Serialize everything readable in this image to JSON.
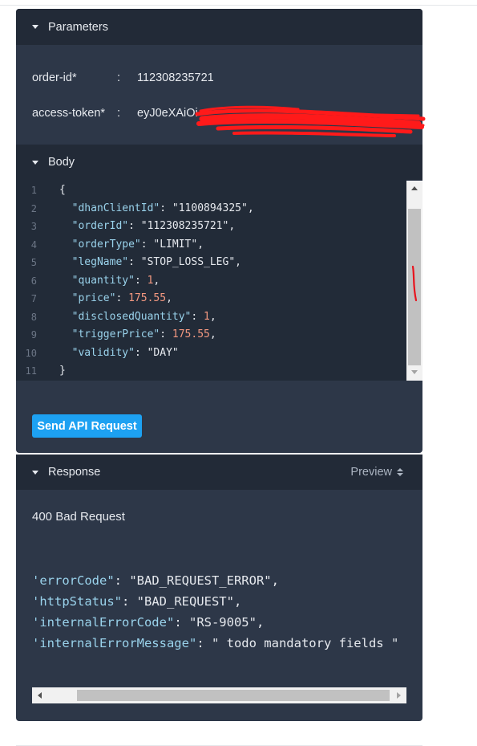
{
  "parameters": {
    "title": "Parameters",
    "rows": [
      {
        "name": "order-id*",
        "value": "112308235721"
      },
      {
        "name": "access-token*",
        "value": "eyJ0eXAiOi"
      }
    ],
    "separator": ":"
  },
  "body": {
    "title": "Body",
    "line_numbers": [
      "1",
      "2",
      "3",
      "4",
      "5",
      "6",
      "7",
      "8",
      "9",
      "10",
      "11"
    ],
    "open_brace": "{",
    "close_brace": "}",
    "fields": [
      {
        "key": "\"dhanClientId\"",
        "value": "\"1100894325\"",
        "kind": "string"
      },
      {
        "key": "\"orderId\"",
        "value": "\"112308235721\"",
        "kind": "string"
      },
      {
        "key": "\"orderType\"",
        "value": "\"LIMIT\"",
        "kind": "string"
      },
      {
        "key": "\"legName\"",
        "value": "\"STOP_LOSS_LEG\"",
        "kind": "string"
      },
      {
        "key": "\"quantity\"",
        "value": "1",
        "kind": "number"
      },
      {
        "key": "\"price\"",
        "value": "175.55",
        "kind": "number"
      },
      {
        "key": "\"disclosedQuantity\"",
        "value": "1",
        "kind": "number"
      },
      {
        "key": "\"triggerPrice\"",
        "value": "175.55",
        "kind": "number"
      },
      {
        "key": "\"validity\"",
        "value": "\"DAY\"",
        "kind": "string"
      }
    ]
  },
  "send_button": {
    "label": "Send API Request"
  },
  "response": {
    "title": "Response",
    "preview_label": "Preview",
    "status": "400 Bad Request",
    "lines": [
      {
        "key": "'errorCode\"",
        "value": "\"BAD_REQUEST_ERROR\","
      },
      {
        "key": "'httpStatus\"",
        "value": "\"BAD_REQUEST\","
      },
      {
        "key": "'internalErrorCode\"",
        "value": "\"RS-9005\","
      },
      {
        "key": "'internalErrorMessage\"",
        "value": "\" todo mandatory fields \""
      }
    ]
  },
  "icons": {
    "section_toggle": "caret-down-icon",
    "preview_sort": "sort-icon"
  },
  "colors": {
    "panel_bg": "#2d3748",
    "header_bg": "#222a37",
    "editor_bg": "#222b38",
    "json_key": "#9ad3ec",
    "json_number": "#f39880",
    "button_bg": "#1da1f2",
    "annotation_red": "#ff0000"
  }
}
